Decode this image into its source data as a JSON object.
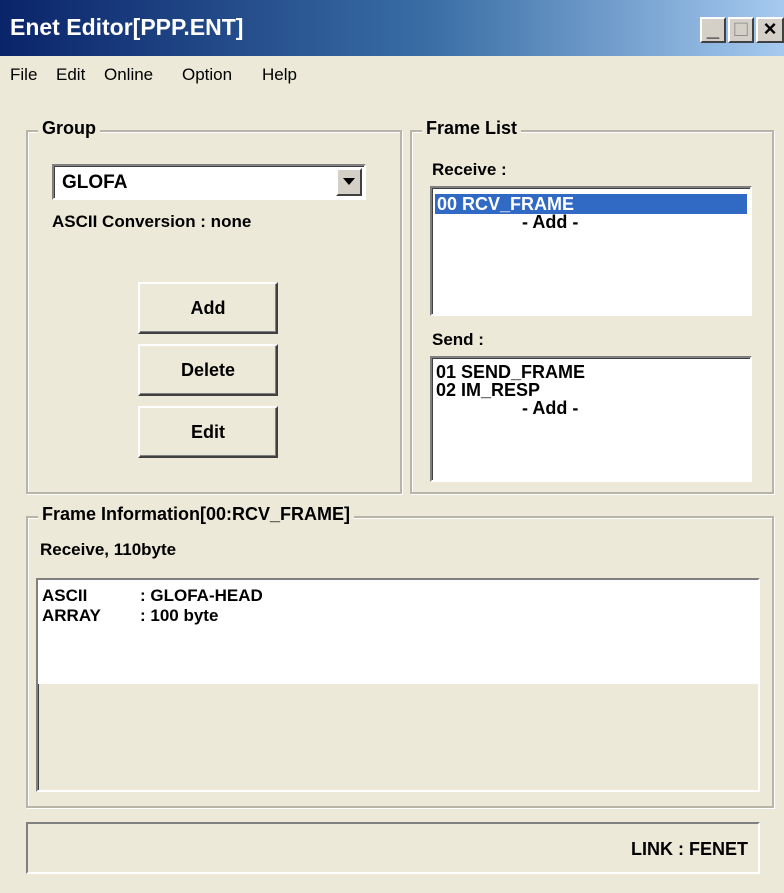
{
  "window": {
    "title": "Enet Editor[PPP.ENT]"
  },
  "title_buttons": {
    "minimize": "_",
    "maximize": "□",
    "close": "×"
  },
  "menu": [
    "File",
    "Edit",
    "Online",
    "Option",
    "Help"
  ],
  "group": {
    "title": "Group",
    "combo_value": "GLOFA",
    "ascii_conversion": "ASCII Conversion : none",
    "buttons": {
      "add": "Add",
      "delete": "Delete",
      "edit": "Edit"
    }
  },
  "frame_list": {
    "title": "Frame List",
    "receive_label": "Receive :",
    "receive_items": [
      "00 RCV_FRAME",
      "- Add -"
    ],
    "send_label": "Send :",
    "send_items": [
      "01 SEND_FRAME",
      "02 IM_RESP",
      "- Add -"
    ]
  },
  "frame_info": {
    "title": "Frame Information[00:RCV_FRAME]",
    "summary": "Receive, 110byte",
    "rows": [
      {
        "key": "ASCII",
        "value": ": GLOFA-HEAD"
      },
      {
        "key": "ARRAY",
        "value": ": 100 byte"
      }
    ]
  },
  "status": {
    "link": "LINK : FENET"
  },
  "colors": {
    "selection": "#316ac5",
    "titlebar_start": "#0a246a",
    "face": "#ece9d8"
  }
}
